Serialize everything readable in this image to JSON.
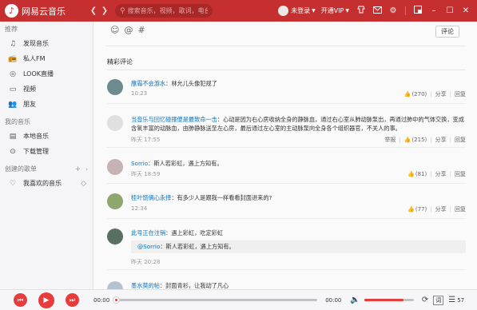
{
  "app": {
    "title": "网易云音乐",
    "accent": "#c62f2f"
  },
  "topbar": {
    "back_icon": "chevron-left-icon",
    "forward_icon": "chevron-right-icon",
    "search_placeholder": "搜索音乐，视频，歌词，电台",
    "login_text": "未登录",
    "login_arrow": "▼",
    "vip_text": "开通VIP",
    "vip_arrow": "▼"
  },
  "sidebar": {
    "recommend_header": "推荐",
    "recommend_items": [
      "发现音乐",
      "私人FM",
      "LOOK直播",
      "视频",
      "朋友"
    ],
    "my_music_header": "我的音乐",
    "my_music_items": [
      "本地音乐",
      "下载管理"
    ],
    "created_header": "创建的歌单",
    "created_plus": "+",
    "favorites": "我喜欢的音乐"
  },
  "main": {
    "comment_button": "评论",
    "section_title": "精彩评论",
    "comments": [
      {
        "user": "蘸霜不会游水",
        "text": "林允儿头像犯规了",
        "time": "10:23",
        "likes": "(270)",
        "share": "分享",
        "reply": "回复"
      },
      {
        "user": "当音乐与回忆碰撞便是最致命一击",
        "text": "心动是因为右心房收纳全身的静脉血，通过右心室从肺动脉泵出，再通过肺中的气体交换，变成含氧丰富的动脉血，由肺静脉送至左心房，最后通过左心室的主动脉泵向全身各个组织器官，不关人的事。",
        "time": "昨天 17:55",
        "report": "举报",
        "likes": "(215)",
        "share": "分享",
        "reply": "回复"
      },
      {
        "user": "Sorrio",
        "text": "斯人若彩虹，遇上方知有。",
        "time": "昨天 18:59",
        "likes": "(81)",
        "share": "分享",
        "reply": "回复"
      },
      {
        "user": "桂叶馈俩心永择",
        "text": "有多少人是跟我一样看看封面进来的?",
        "time": "12:34",
        "likes": "(77)",
        "share": "分享",
        "reply": "回复"
      },
      {
        "user": "此号正在注销",
        "text": "遇上彩虹，吃定彩虹",
        "quote_user": "@Sorrio",
        "quote_text": "斯人若彩虹，遇上方知有。",
        "time": "昨天 20:28"
      },
      {
        "user": "墨水莫的帖",
        "text": "封面青衫，让我动了凡心"
      }
    ]
  },
  "player": {
    "current_time": "00:00",
    "total_time": "00:00",
    "progress": 0,
    "volume": 0.8,
    "playlist_count": "57",
    "lyric_label": "词"
  }
}
